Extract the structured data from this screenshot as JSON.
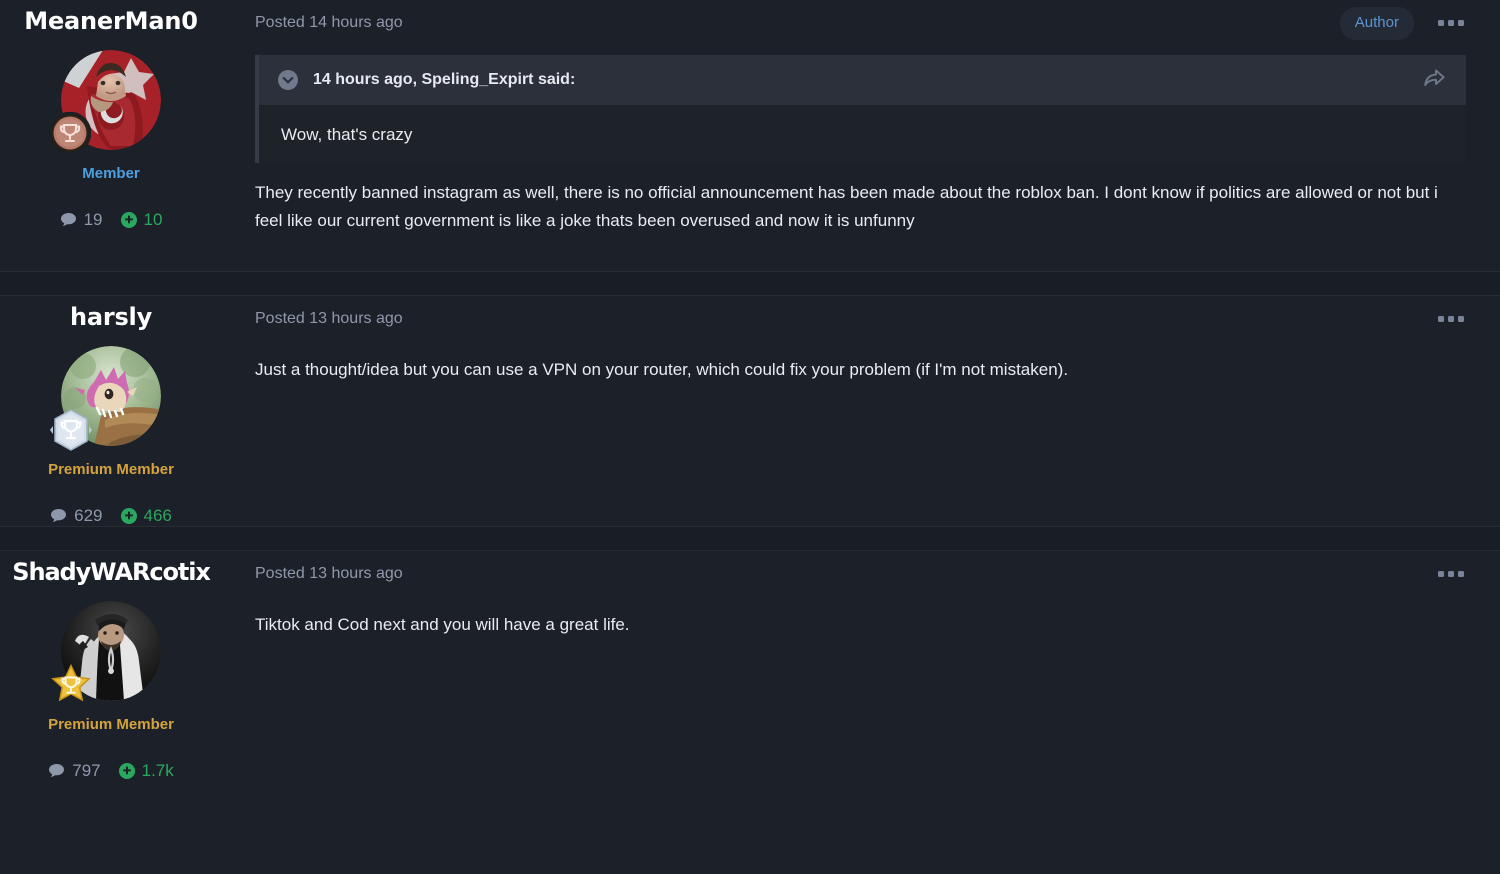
{
  "theme": {
    "page_bg": "#1c2028",
    "gap_bg": "#191d24",
    "quote_head_bg": "#2b303b",
    "quote_body_bg": "#1e2229",
    "text": "#e9ecf1",
    "muted": "#8f99ab",
    "member_color": "#4e9fe0",
    "premium_color": "#d5a33e",
    "rep_green": "#2aa85f",
    "author_badge_text": "#5b93d1",
    "author_badge_bg": "#252b36"
  },
  "posts": [
    {
      "username": "MeanerMan0",
      "rank_label": "Member",
      "rank_type": "member",
      "badge_icon": "bronze-trophy-badge-icon",
      "avatar_alt": "avatar-meanerman0",
      "comments_icon": "comment-bubble-icon",
      "comments_count": "19",
      "rep_icon": "reputation-plus-icon",
      "rep_count": "10",
      "posted": "Posted 14 hours ago",
      "author_badge": "Author",
      "menu_icon": "ellipsis-menu-icon",
      "quote": {
        "citation": "14 hours ago, Speling_Expirt said:",
        "collapse_icon": "chevron-down-circle-icon",
        "share_icon": "reply-arrow-icon",
        "text": "Wow, that's crazy"
      },
      "body": "They recently banned instagram as well, there is no official announcement has been made about the roblox ban. I dont know if politics are allowed or not but i feel like our current government is like a joke thats been overused and now it is unfunny"
    },
    {
      "username": "harsly",
      "rank_label": "Premium Member",
      "rank_type": "premium",
      "badge_icon": "silver-hex-trophy-badge-icon",
      "avatar_alt": "avatar-harsly",
      "comments_icon": "comment-bubble-icon",
      "comments_count": "629",
      "rep_icon": "reputation-plus-icon",
      "rep_count": "466",
      "posted": "Posted 13 hours ago",
      "author_badge": null,
      "menu_icon": "ellipsis-menu-icon",
      "quote": null,
      "body": "Just a thought/idea but you can use a VPN on your router, which could fix your problem (if I'm not mistaken)."
    },
    {
      "username": "ShadyWARcotix",
      "rank_label": "Premium Member",
      "rank_type": "premium",
      "badge_icon": "gold-star-trophy-badge-icon",
      "avatar_alt": "avatar-shadywarcotix",
      "comments_icon": "comment-bubble-icon",
      "comments_count": "797",
      "rep_icon": "reputation-plus-icon",
      "rep_count": "1.7k",
      "posted": "Posted 13 hours ago",
      "author_badge": null,
      "menu_icon": "ellipsis-menu-icon",
      "quote": null,
      "body": "Tiktok and Cod next and you will have a great life."
    }
  ]
}
